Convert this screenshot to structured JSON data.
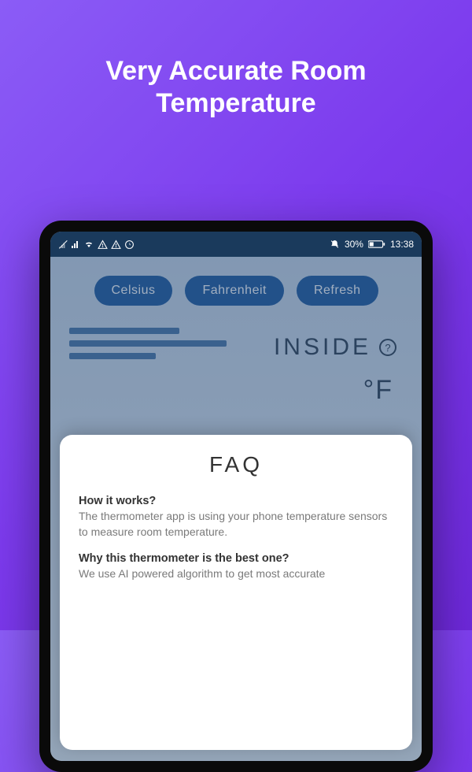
{
  "headline": "Very Accurate Room\nTemperature",
  "status_bar": {
    "battery_text": "30%",
    "time": "13:38"
  },
  "buttons": {
    "celsius": "Celsius",
    "fahrenheit": "Fahrenheit",
    "refresh": "Refresh"
  },
  "inside_label": "INSIDE",
  "unit_label": "°F",
  "faq": {
    "title": "FAQ",
    "q1": "How it works?",
    "a1": "The thermometer app is using your phone temperature sensors to measure room temperature.",
    "q2": "Why this thermometer is the best one?",
    "a2": "We use AI powered algorithm to get most accurate"
  }
}
